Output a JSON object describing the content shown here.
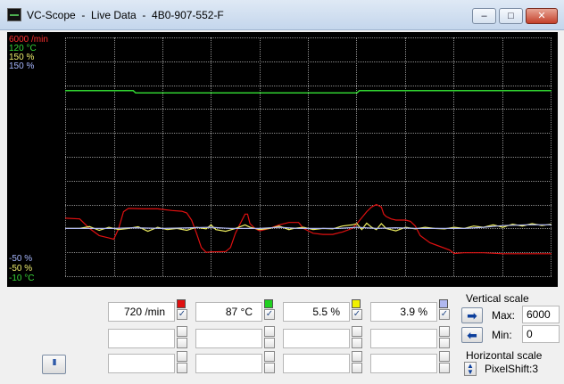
{
  "window": {
    "title": "VC-Scope  -  Live Data  -  4B0-907-552-F",
    "minimize_glyph": "–",
    "maximize_glyph": "□",
    "close_glyph": "✕"
  },
  "scale_labels_top": [
    {
      "text": "6000 /min",
      "color": "#ff3030"
    },
    {
      "text": "120 °C",
      "color": "#38d838"
    },
    {
      "text": "150 %",
      "color": "#f0f070"
    },
    {
      "text": "150 %",
      "color": "#a8b8ff"
    }
  ],
  "scale_labels_bottom": [
    {
      "text": "-50 %",
      "color": "#a8b8ff"
    },
    {
      "text": "-50 %",
      "color": "#f0f070"
    },
    {
      "text": "-10 °C",
      "color": "#38d838"
    }
  ],
  "channels": [
    {
      "value": "720 /min",
      "color": "#e01010",
      "checked": true
    },
    {
      "value": "87 °C",
      "color": "#20d020",
      "checked": true
    },
    {
      "value": "5.5 %",
      "color": "#f0f000",
      "checked": true
    },
    {
      "value": "3.9 %",
      "color": "#b0b8f0",
      "checked": true
    }
  ],
  "empty_rows": 2,
  "controls": {
    "pause_glyph": "II",
    "vertical_scale_label": "Vertical scale",
    "max_label": "Max:",
    "max_value": "6000",
    "min_label": "Min:",
    "min_value": "0",
    "horizontal_scale_label": "Horizontal scale",
    "pixelshift_label": "PixelShift:3"
  },
  "chart_data": {
    "type": "line",
    "series": [
      {
        "color": "#e01010",
        "values": [
          [
            0,
            0.243
          ],
          [
            3,
            0.24
          ],
          [
            5,
            0.2
          ],
          [
            7,
            0.17
          ],
          [
            9,
            0.16
          ],
          [
            10,
            0.155
          ],
          [
            11,
            0.2
          ],
          [
            12,
            0.27
          ],
          [
            13,
            0.284
          ],
          [
            16,
            0.282
          ],
          [
            19,
            0.282
          ],
          [
            22,
            0.275
          ],
          [
            24,
            0.272
          ],
          [
            25,
            0.265
          ],
          [
            26,
            0.235
          ],
          [
            27,
            0.18
          ],
          [
            28,
            0.12
          ],
          [
            29,
            0.1
          ],
          [
            30,
            0.102
          ],
          [
            33,
            0.103
          ],
          [
            34,
            0.12
          ],
          [
            35,
            0.18
          ],
          [
            36,
            0.22
          ],
          [
            37,
            0.26
          ],
          [
            37.5,
            0.26
          ],
          [
            38,
            0.22
          ],
          [
            39,
            0.2
          ],
          [
            40,
            0.19
          ],
          [
            42,
            0.2
          ],
          [
            44,
            0.215
          ],
          [
            46,
            0.225
          ],
          [
            48,
            0.225
          ],
          [
            49,
            0.2
          ],
          [
            51,
            0.18
          ],
          [
            53,
            0.175
          ],
          [
            55,
            0.175
          ],
          [
            57,
            0.185
          ],
          [
            59,
            0.2
          ],
          [
            60,
            0.22
          ],
          [
            62,
            0.27
          ],
          [
            63,
            0.29
          ],
          [
            64,
            0.3
          ],
          [
            65,
            0.29
          ],
          [
            65.5,
            0.26
          ],
          [
            66,
            0.25
          ],
          [
            67,
            0.24
          ],
          [
            68,
            0.235
          ],
          [
            70,
            0.235
          ],
          [
            71,
            0.23
          ],
          [
            72,
            0.21
          ],
          [
            73,
            0.17
          ],
          [
            75,
            0.14
          ],
          [
            77,
            0.125
          ],
          [
            79,
            0.11
          ],
          [
            80,
            0.095
          ],
          [
            82,
            0.098
          ],
          [
            86,
            0.098
          ],
          [
            90,
            0.094
          ],
          [
            100,
            0.094
          ]
        ]
      },
      {
        "color": "#30d030",
        "values": [
          [
            0,
            0.777
          ],
          [
            10,
            0.777
          ],
          [
            14,
            0.777
          ],
          [
            14.5,
            0.768
          ],
          [
            30,
            0.768
          ],
          [
            60,
            0.768
          ],
          [
            60.5,
            0.777
          ],
          [
            75,
            0.777
          ],
          [
            100,
            0.777
          ]
        ]
      },
      {
        "color": "#f0f060",
        "values": [
          [
            0,
            0.2
          ],
          [
            3,
            0.2
          ],
          [
            5,
            0.208
          ],
          [
            7,
            0.192
          ],
          [
            9,
            0.205
          ],
          [
            11,
            0.195
          ],
          [
            13,
            0.2
          ],
          [
            15,
            0.207
          ],
          [
            17,
            0.188
          ],
          [
            19,
            0.205
          ],
          [
            21,
            0.195
          ],
          [
            23,
            0.2
          ],
          [
            25,
            0.192
          ],
          [
            27,
            0.205
          ],
          [
            29,
            0.198
          ],
          [
            30,
            0.215
          ],
          [
            31,
            0.195
          ],
          [
            33,
            0.188
          ],
          [
            35,
            0.2
          ],
          [
            37,
            0.215
          ],
          [
            38,
            0.205
          ],
          [
            40,
            0.195
          ],
          [
            42,
            0.2
          ],
          [
            44,
            0.21
          ],
          [
            46,
            0.195
          ],
          [
            47,
            0.2
          ],
          [
            49,
            0.205
          ],
          [
            51,
            0.195
          ],
          [
            53,
            0.2
          ],
          [
            55,
            0.198
          ],
          [
            57,
            0.21
          ],
          [
            59,
            0.215
          ],
          [
            60,
            0.22
          ],
          [
            61,
            0.195
          ],
          [
            62,
            0.222
          ],
          [
            63,
            0.205
          ],
          [
            64,
            0.195
          ],
          [
            65,
            0.22
          ],
          [
            66,
            0.2
          ],
          [
            68,
            0.19
          ],
          [
            70,
            0.205
          ],
          [
            72,
            0.198
          ],
          [
            74,
            0.205
          ],
          [
            76,
            0.2
          ],
          [
            78,
            0.198
          ],
          [
            80,
            0.205
          ],
          [
            82,
            0.2
          ],
          [
            84,
            0.21
          ],
          [
            86,
            0.205
          ],
          [
            88,
            0.215
          ],
          [
            90,
            0.205
          ],
          [
            92,
            0.218
          ],
          [
            94,
            0.21
          ],
          [
            96,
            0.22
          ],
          [
            98,
            0.212
          ],
          [
            100,
            0.218
          ]
        ]
      },
      {
        "color": "#b0b8f0",
        "values": [
          [
            0,
            0.2
          ],
          [
            5,
            0.2
          ],
          [
            10,
            0.2
          ],
          [
            14,
            0.203
          ],
          [
            20,
            0.2
          ],
          [
            26,
            0.203
          ],
          [
            30,
            0.205
          ],
          [
            34,
            0.2
          ],
          [
            40,
            0.2
          ],
          [
            44,
            0.205
          ],
          [
            48,
            0.2
          ],
          [
            52,
            0.2
          ],
          [
            56,
            0.2
          ],
          [
            60,
            0.205
          ],
          [
            64,
            0.2
          ],
          [
            68,
            0.203
          ],
          [
            72,
            0.2
          ],
          [
            78,
            0.2
          ],
          [
            82,
            0.2
          ],
          [
            86,
            0.205
          ],
          [
            90,
            0.212
          ],
          [
            95,
            0.215
          ],
          [
            100,
            0.215
          ]
        ]
      }
    ]
  }
}
